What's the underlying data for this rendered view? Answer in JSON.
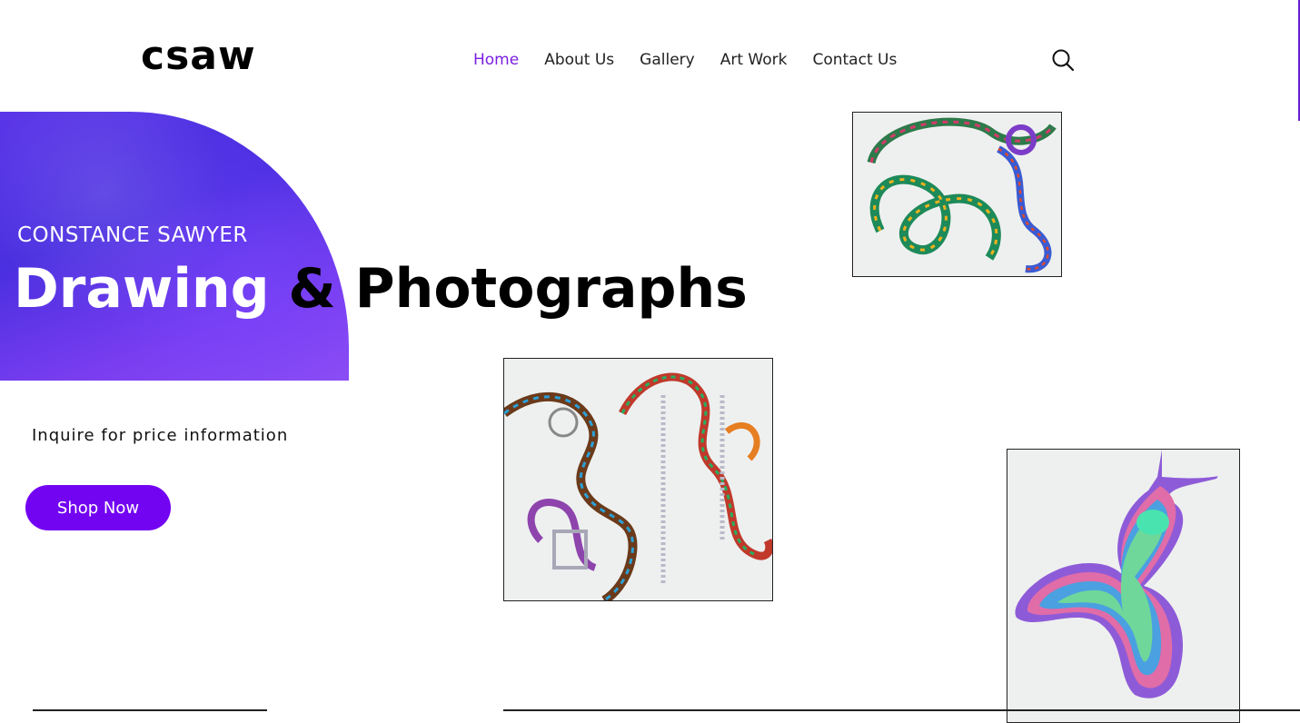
{
  "brand": {
    "logo": "csaw"
  },
  "nav": {
    "items": [
      {
        "label": "Home",
        "active": true
      },
      {
        "label": "About Us",
        "active": false
      },
      {
        "label": "Gallery",
        "active": false
      },
      {
        "label": "Art Work",
        "active": false
      },
      {
        "label": "Contact Us",
        "active": false
      }
    ],
    "search_icon": "search-icon"
  },
  "hero": {
    "subtitle": "CONSTANCE SAWYER",
    "title_part1": "Drawing",
    "title_part2": " & Photographs",
    "inquire_text": "Inquire for price information",
    "cta_label": "Shop Now"
  },
  "colors": {
    "accent": "#7304f2",
    "active_nav": "#7a1fe0",
    "hero_blob": "#5a36e8"
  }
}
